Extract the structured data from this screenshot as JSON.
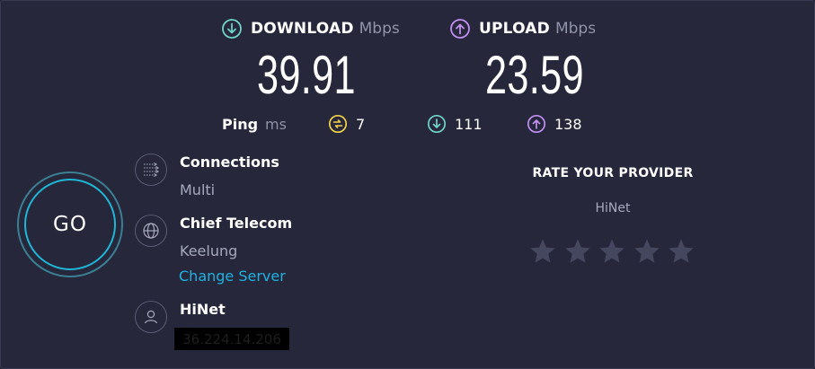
{
  "download": {
    "label": "DOWNLOAD",
    "unit": "Mbps",
    "value": "39.91",
    "color": "#6fd3c8"
  },
  "upload": {
    "label": "UPLOAD",
    "unit": "Mbps",
    "value": "23.59",
    "color": "#c08ff0"
  },
  "ping": {
    "label": "Ping",
    "unit": "ms",
    "jitter_value": "7",
    "download_value": "111",
    "upload_value": "138",
    "jitter_color": "#f0d24a"
  },
  "go_button": {
    "label": "GO",
    "ring_color": "#1fb6d6"
  },
  "connections": {
    "title": "Connections",
    "value": "Multi",
    "icon": "connections-icon"
  },
  "server": {
    "name": "Chief Telecom",
    "location": "Keelung",
    "change_label": "Change Server",
    "icon": "globe-icon"
  },
  "provider": {
    "name": "HiNet",
    "ip": "36.224.14.206",
    "icon": "user-icon"
  },
  "rating": {
    "title": "RATE YOUR PROVIDER",
    "provider": "HiNet",
    "stars": 5,
    "star_color": "#45475e"
  }
}
